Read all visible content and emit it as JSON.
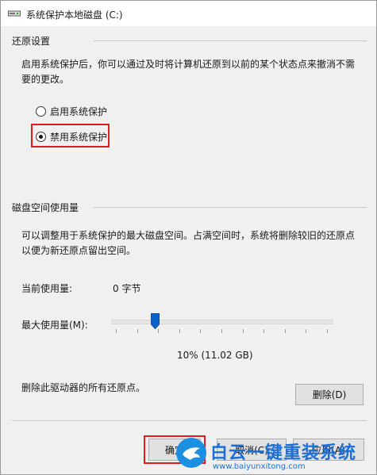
{
  "window": {
    "title": "系统保护本地磁盘 (C:)",
    "title_icon": "drive-icon"
  },
  "restore_settings": {
    "group_label": "还原设置",
    "description_line1": "启用系统保护后，你可以通过及时将计算机还原到以前的某个状态点来撤消不需",
    "description_line2": "要的更改。",
    "options": [
      {
        "label": "启用系统保护",
        "checked": false
      },
      {
        "label": "禁用系统保护",
        "checked": true
      }
    ]
  },
  "disk_usage": {
    "group_label": "磁盘空间使用量",
    "description_line1": "可以调整用于系统保护的最大磁盘空间。占满空间时，系统将删除较旧的还原点",
    "description_line2": "以便为新还原点留出空间。",
    "current_usage_label": "当前使用量:",
    "current_usage_value": "0 字节",
    "max_usage_label": "最大使用量(M):",
    "max_usage_fraction": 0.1,
    "max_usage_display": "10% (11.02 GB)",
    "delete_text": "删除此驱动器的所有还原点。",
    "delete_button": "删除(D)"
  },
  "footer": {
    "ok_button": "确定",
    "cancel_button": "取消(C)",
    "apply_button": "应用(A)"
  },
  "watermark": {
    "brand": "白云一键重装系统",
    "url": "www.baiyunxitong.com"
  },
  "colors": {
    "highlight": "#e11b1b",
    "slider_thumb": "#0a64c8",
    "watermark": "#1d6fd6"
  }
}
